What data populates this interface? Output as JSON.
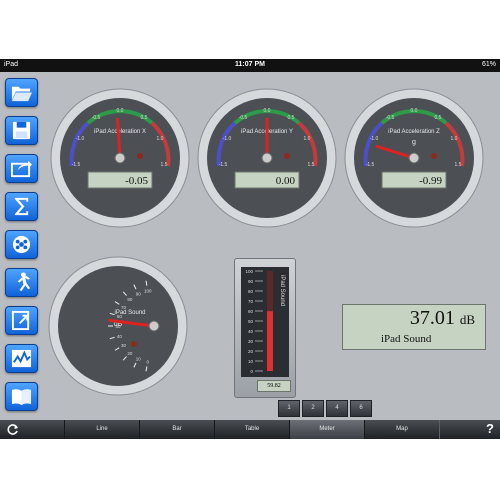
{
  "status": {
    "device": "iPad",
    "time": "11:07 PM",
    "battery": "61%"
  },
  "sidebar": {
    "items": [
      {
        "icon": "folder-open-icon"
      },
      {
        "icon": "save-icon"
      },
      {
        "icon": "share-icon"
      },
      {
        "icon": "sigma-icon"
      },
      {
        "icon": "film-reel-icon"
      },
      {
        "icon": "runner-icon"
      },
      {
        "icon": "export-icon"
      },
      {
        "icon": "chart-line-icon"
      },
      {
        "icon": "book-icon"
      }
    ]
  },
  "gauges": {
    "accel_x": {
      "label": "iPad Acceleration X",
      "value": "-0.05",
      "needle": -0.05
    },
    "accel_y": {
      "label": "iPad Acceleration Y",
      "value": "0.00",
      "needle": 0.0
    },
    "accel_z": {
      "label": "iPad Acceleration Z",
      "unit": "g",
      "value": "-0.99",
      "needle": -0.99
    },
    "scale_ticks": [
      "-1.0",
      "-0.5",
      "0.0",
      "0.5",
      "1.0"
    ],
    "end_ticks": [
      "-1.5",
      "1.5"
    ],
    "sound": {
      "label": "iPad Sound",
      "unit": "dB",
      "needle": 37.01,
      "ticks": [
        "100",
        "90",
        "80",
        "70",
        "60",
        "50",
        "40",
        "30",
        "20",
        "10",
        "0"
      ]
    }
  },
  "bar_meter": {
    "label": "iPad Sound",
    "value": "59.82",
    "fill": 59.82,
    "ticks": [
      "100",
      "90",
      "80",
      "70",
      "60",
      "50",
      "40",
      "30",
      "20",
      "10",
      "0"
    ]
  },
  "display": {
    "value": "37.01",
    "unit": "dB",
    "label": "iPad Sound"
  },
  "pager": [
    "1",
    "2",
    "4",
    "6"
  ],
  "tabs": [
    "Line",
    "Bar",
    "Table",
    "Meter",
    "Map"
  ],
  "help_label": "?"
}
